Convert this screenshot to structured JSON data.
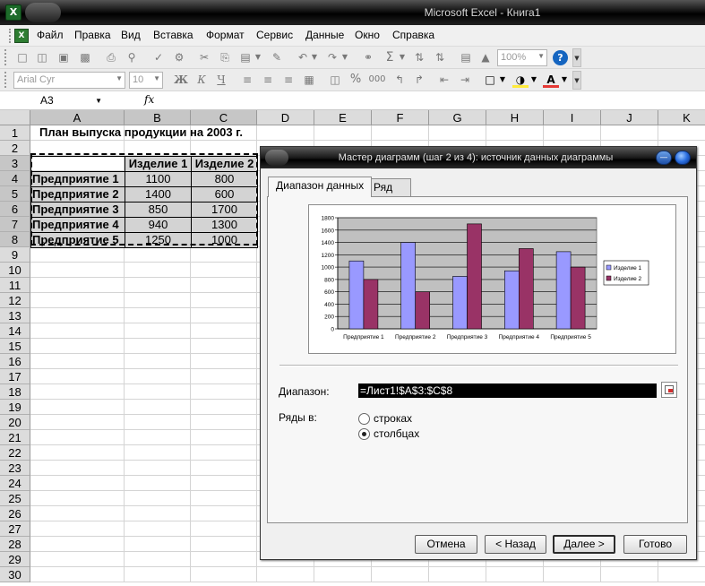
{
  "app": {
    "title": "Microsoft Excel - Книга1",
    "icon_name": "excel-icon"
  },
  "menu": {
    "items": [
      "Файл",
      "Правка",
      "Вид",
      "Вставка",
      "Формат",
      "Сервис",
      "Данные",
      "Окно",
      "Справка"
    ]
  },
  "toolbar": {
    "zoom": "100%",
    "font_name": "Arial Cyr",
    "font_size": "10",
    "bold": "Ж",
    "italic": "К",
    "underline": "Ч",
    "percent": "%",
    "thousands": "000",
    "sum": "Σ",
    "help": "?",
    "font_color_letter": "A"
  },
  "formula_bar": {
    "name_box": "A3",
    "fx": "fx"
  },
  "sheet": {
    "columns": [
      "A",
      "B",
      "C",
      "D",
      "E",
      "F",
      "G",
      "H",
      "I",
      "J",
      "K"
    ],
    "rows": [
      "1",
      "2",
      "3",
      "4",
      "5",
      "6",
      "7",
      "8",
      "9",
      "10",
      "11",
      "12",
      "13",
      "14",
      "15",
      "16",
      "17",
      "18",
      "19",
      "20",
      "21",
      "22",
      "23",
      "24",
      "25",
      "26",
      "27",
      "28",
      "29",
      "30"
    ],
    "title": "План выпуска продукции на 2003 г.",
    "header": [
      "",
      "Изделие 1",
      "Изделие 2"
    ],
    "data": [
      [
        "Предприятие 1",
        "1100",
        "800"
      ],
      [
        "Предприятие 2",
        "1400",
        "600"
      ],
      [
        "Предприятие 3",
        "850",
        "1700"
      ],
      [
        "Предприятие 4",
        "940",
        "1300"
      ],
      [
        "Предприятие 5",
        "1250",
        "1000"
      ]
    ]
  },
  "dialog": {
    "title": "Мастер диаграмм (шаг 2 из 4): источник данных диаграммы",
    "tabs": [
      "Диапазон данных",
      "Ряд"
    ],
    "range_label": "Диапазон:",
    "range_value": "=Лист1!$A$3:$C$8",
    "series_in_label": "Ряды в:",
    "radio_rows": "строках",
    "radio_cols": "столбцах",
    "selected_series_in": "столбцах",
    "buttons": {
      "cancel": "Отмена",
      "back": "< Назад",
      "next": "Далее >",
      "finish": "Готово"
    }
  },
  "chart_data": {
    "type": "bar",
    "categories": [
      "Предприятие 1",
      "Предприятие 2",
      "Предприятие 3",
      "Предприятие 4",
      "Предприятие 5"
    ],
    "series": [
      {
        "name": "Изделие 1",
        "values": [
          1100,
          1400,
          850,
          940,
          1250
        ],
        "color": "#9999ff"
      },
      {
        "name": "Изделие 2",
        "values": [
          800,
          600,
          1700,
          1300,
          1000
        ],
        "color": "#993366"
      }
    ],
    "yticks": [
      "0",
      "200",
      "400",
      "600",
      "800",
      "1000",
      "1200",
      "1400",
      "1600",
      "1800"
    ],
    "ylim": [
      0,
      1800
    ],
    "plot_background": "#c0c0c0",
    "grid": true,
    "legend": "right"
  }
}
